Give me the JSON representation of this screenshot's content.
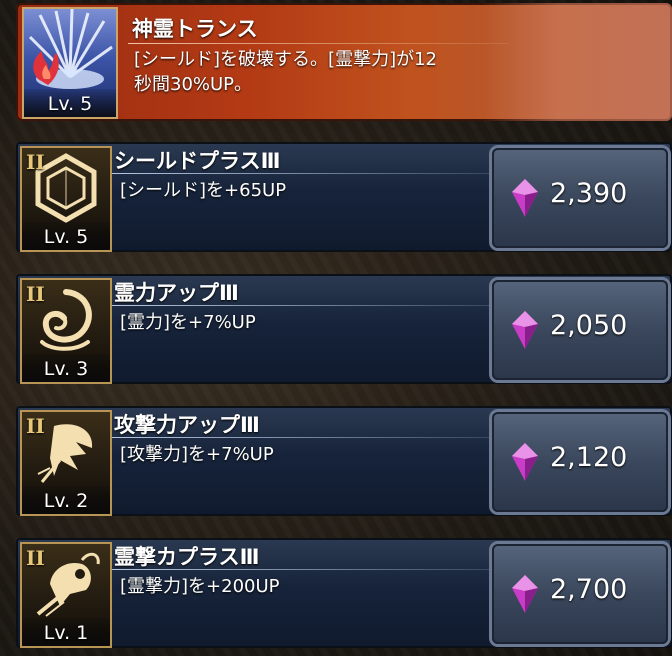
{
  "featured_skill": {
    "title": "神霊トランス",
    "description_line1": "[シールド]を破壊する。[霊撃力]が12",
    "description_line2": "秒間30%UP。",
    "level": "Lv. 5",
    "icon": "spirit-trance-flame-icon"
  },
  "upgrades": [
    {
      "rank": "II",
      "name": "シールドプラスⅢ",
      "effect": "[シールド]を+65UP",
      "level": "Lv. 5",
      "cost": "2,390",
      "icon": "hexagon-shield-icon"
    },
    {
      "rank": "II",
      "name": "霊力アップⅢ",
      "effect": "[霊力]を+7%UP",
      "level": "Lv. 3",
      "cost": "2,050",
      "icon": "spirit-swirl-icon"
    },
    {
      "rank": "II",
      "name": "攻撃力アップⅢ",
      "effect": "[攻撃力]を+7%UP",
      "level": "Lv. 2",
      "cost": "2,120",
      "icon": "sword-strike-icon"
    },
    {
      "rank": "II",
      "name": "霊撃カプラスⅢ",
      "effect": "[霊撃力]を+200UP",
      "level": "Lv. 1",
      "cost": "2,700",
      "icon": "spirit-fist-icon"
    }
  ],
  "currency_icon": "purple-gem-icon",
  "colors": {
    "gem": "#c83cc8",
    "gold": "#e8c77a",
    "featured_bg": "#b33a14",
    "card_bg": "#16233a"
  }
}
